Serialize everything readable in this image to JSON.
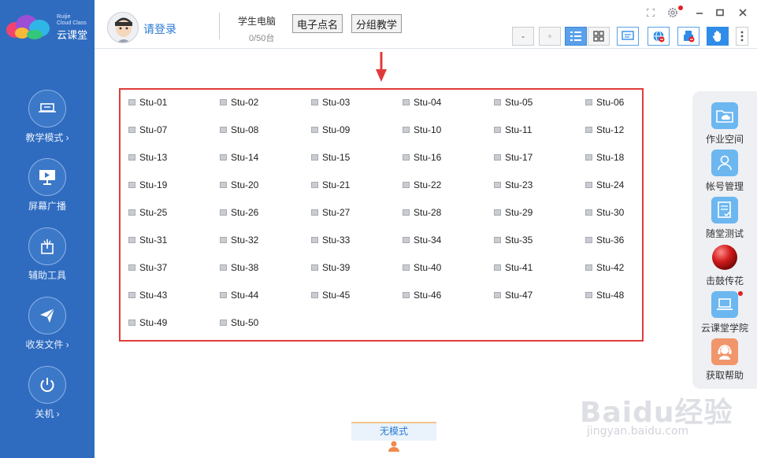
{
  "logo": {
    "brand_en_line1": "Ruijie",
    "brand_en_line2": "Cloud Class",
    "brand_cn": "云课堂"
  },
  "sidebar": {
    "items": [
      {
        "label": "教学模式 ›",
        "icon": "teaching-mode-icon"
      },
      {
        "label": "屏幕广播",
        "icon": "screen-broadcast-icon"
      },
      {
        "label": "辅助工具",
        "icon": "tools-icon"
      },
      {
        "label": "收发文件 ›",
        "icon": "send-file-icon"
      },
      {
        "label": "关机 ›",
        "icon": "power-icon"
      }
    ]
  },
  "header": {
    "login_text": "请登录",
    "student_pc_label": "学生电脑",
    "student_pc_count": "0/50台",
    "roll_call_label": "电子点名",
    "group_teaching_label": "分组教学",
    "zoom_out_label": "-",
    "zoom_in_label": "+"
  },
  "students": [
    "Stu-01",
    "Stu-02",
    "Stu-03",
    "Stu-04",
    "Stu-05",
    "Stu-06",
    "Stu-07",
    "Stu-08",
    "Stu-09",
    "Stu-10",
    "Stu-11",
    "Stu-12",
    "Stu-13",
    "Stu-14",
    "Stu-15",
    "Stu-16",
    "Stu-17",
    "Stu-18",
    "Stu-19",
    "Stu-20",
    "Stu-21",
    "Stu-22",
    "Stu-23",
    "Stu-24",
    "Stu-25",
    "Stu-26",
    "Stu-27",
    "Stu-28",
    "Stu-29",
    "Stu-30",
    "Stu-31",
    "Stu-32",
    "Stu-33",
    "Stu-34",
    "Stu-35",
    "Stu-36",
    "Stu-37",
    "Stu-38",
    "Stu-39",
    "Stu-40",
    "Stu-41",
    "Stu-42",
    "Stu-43",
    "Stu-44",
    "Stu-45",
    "Stu-46",
    "Stu-47",
    "Stu-48",
    "Stu-49",
    "Stu-50"
  ],
  "right_panel": {
    "items": [
      {
        "label": "作业空间",
        "icon": "homework-folder-icon"
      },
      {
        "label": "帐号管理",
        "icon": "account-icon"
      },
      {
        "label": "随堂测试",
        "icon": "quiz-icon"
      },
      {
        "label": "击鼓传花",
        "icon": "red-ball-icon"
      },
      {
        "label": "云课堂学院",
        "icon": "academy-laptop-icon"
      },
      {
        "label": "获取帮助",
        "icon": "help-headset-icon"
      }
    ]
  },
  "mode": {
    "label": "无模式"
  },
  "watermark": {
    "main": "Baidu经验",
    "sub": "jingyan.baidu.com"
  },
  "colors": {
    "sidebar": "#2f6cc0",
    "accent": "#2a7ad6",
    "highlight_border": "#e23a3a"
  }
}
